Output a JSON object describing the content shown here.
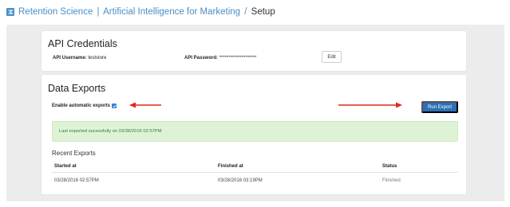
{
  "header": {
    "brand": "Retention Science",
    "sep1": "|",
    "section": "Artificial Intelligence for Marketing",
    "sep2": "/",
    "page": "Setup",
    "brand_color": "#4a8ec6",
    "logo_icon": "retention-science-logo-icon"
  },
  "api_credentials": {
    "title": "API Credentials",
    "username_label": "API Username:",
    "username_value": "teststore",
    "password_label": "API Password:",
    "password_value": "********************",
    "edit_label": "Edit"
  },
  "data_exports": {
    "title": "Data Exports",
    "auto_label": "Enable automatic exports",
    "auto_checked": true,
    "run_label": "Run Export",
    "run_color": "#2d6fb5",
    "alert_text": "Last exported sucessfully on 03/28/2016 02:57PM",
    "alert_color": "#def3d6",
    "annotation_arrow_color": "#e2261c"
  },
  "recent_exports": {
    "title": "Recent Exports",
    "columns": [
      "Started at",
      "Finished at",
      "Status"
    ],
    "rows": [
      [
        "03/28/2016 02:57PM",
        "03/28/2016 03:19PM",
        "Finished"
      ]
    ]
  }
}
